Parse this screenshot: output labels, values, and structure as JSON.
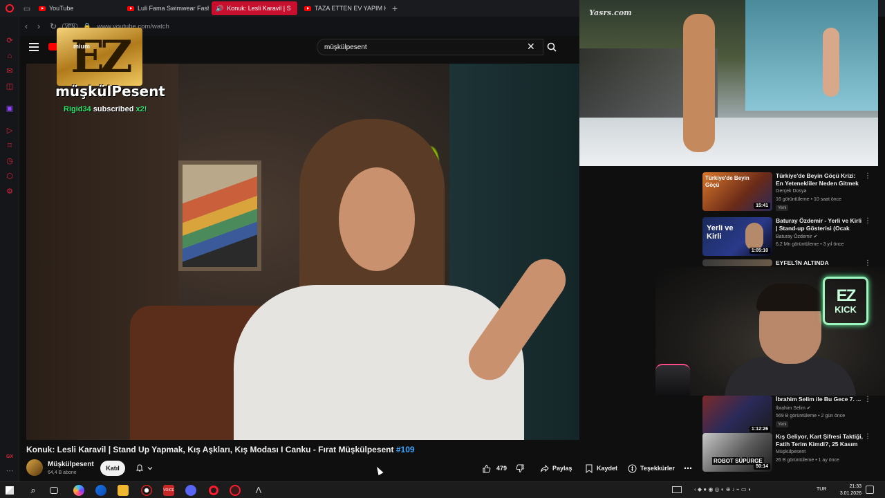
{
  "browser": {
    "tabs": [
      {
        "label": "YouTube"
      },
      {
        "label": "Luli Fama Swimwear Fash"
      },
      {
        "label": "Konuk: Lesli Karavil | S"
      },
      {
        "label": "TAZA ETTEN EV YAPIM K"
      }
    ],
    "vpn_label": "VPN",
    "url": "www.youtube.com/watch"
  },
  "youtube": {
    "search_value": "müşkülpesent"
  },
  "overlay": {
    "ez_logo": "EZ",
    "logo_small": "mium",
    "streamer_name": "müşkülPesent",
    "sub_alert_user": "Rigid34",
    "sub_alert_text": "subscribed",
    "sub_alert_mult": "x2!",
    "runway_watermark": "Yasrs.com",
    "neon_big": "EZ",
    "neon_small": "KICK"
  },
  "video": {
    "title": "Konuk: Lesli Karavil | Stand Up Yapmak, Kış Aşkları, Kış Modası I Canku - Fırat Müşkülpesent",
    "hashtag": "#109",
    "channel": "Müşkülpesent",
    "subscribers": "64,4 B abone",
    "join_label": "Katıl",
    "likes": "479",
    "share_label": "Paylaş",
    "save_label": "Kaydet",
    "thanks_label": "Teşekkürler"
  },
  "recommended": [
    {
      "title": "Türkiye'de Beyin Göçü Krizi: En Yetenekliler Neden Gitmek ...",
      "channel": "Gerçek Dosya",
      "meta": "16 görüntüleme • 10 saat önce",
      "badge": "Yeni",
      "duration": "15:41",
      "thumb_text": "Türkiye'de Beyin Göçü"
    },
    {
      "title": "Baturay Özdemir - Yerli ve Kirli | Stand-up Gösterisi (Ocak 2022)",
      "channel": "Baturay Özdemir",
      "meta": "6,2 Mn görüntüleme • 3 yıl önce",
      "badge": "",
      "duration": "1:05:10",
      "thumb_text": "Yerli ve Kirli"
    },
    {
      "title": "EYFEL'İN ALTINDA",
      "channel": "",
      "meta": "",
      "badge": "",
      "duration": "",
      "thumb_text": ""
    },
    {
      "title": "İbrahim Selim ile Bu Gece 7. ...",
      "channel": "İbrahim Selim",
      "meta": "569 B görüntüleme • 2 gün önce",
      "badge": "Yeni",
      "duration": "1:12:26",
      "thumb_text": ""
    },
    {
      "title": "Kış Geliyor, Kart Şifresi Taktiği, Fatih Terim Kimdi?, 25 Kasım ...",
      "channel": "Müşkülpesent",
      "meta": "26 B görüntüleme • 1 ay önce",
      "badge": "",
      "duration": "50:14",
      "thumb_text": "ROBOT SÜPÜRGE"
    }
  ],
  "taskbar": {
    "lang": "TUR",
    "time": "21:33",
    "date": "3.01.2026"
  },
  "colors": {
    "accent": "#c8102e",
    "youtube_red": "#ff0000",
    "link_blue": "#3ea6ff"
  }
}
